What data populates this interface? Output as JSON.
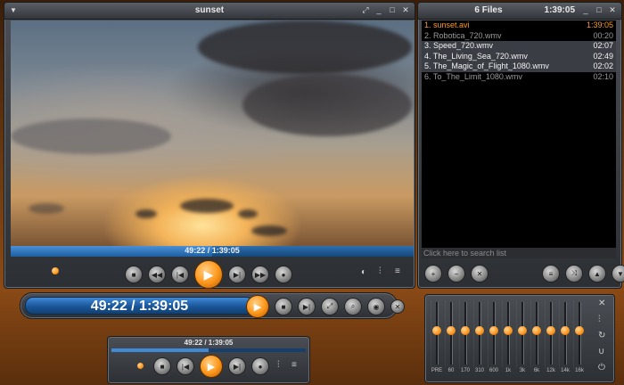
{
  "main_window": {
    "title": "sunset",
    "seek_time": "49:22 / 1:39:05",
    "progress_fraction": 0.5
  },
  "playlist": {
    "title": "6 Files",
    "total_time": "1:39:05",
    "items": [
      {
        "name": "1. sunset.avi",
        "duration": "1:39:05",
        "state": "active"
      },
      {
        "name": "2. Robotica_720.wmv",
        "duration": "00:20",
        "state": "normal"
      },
      {
        "name": "3. Speed_720.wmv",
        "duration": "02:07",
        "state": "selected"
      },
      {
        "name": "4. The_Living_Sea_720.wmv",
        "duration": "02:49",
        "state": "selected"
      },
      {
        "name": "5. The_Magic_of_Flight_1080.wmv",
        "duration": "02:02",
        "state": "selected"
      },
      {
        "name": "6. To_The_Limit_1080.wmv",
        "duration": "02:10",
        "state": "normal"
      }
    ],
    "search_placeholder": "Click here to search list"
  },
  "mini_bar": {
    "time": "49:22 / 1:39:05"
  },
  "small_player": {
    "time": "49:22 / 1:39:05",
    "progress_fraction": 0.5
  },
  "equalizer": {
    "bands": [
      {
        "label": "PRE",
        "level": 0.55
      },
      {
        "label": "60",
        "level": 0.55
      },
      {
        "label": "170",
        "level": 0.55
      },
      {
        "label": "310",
        "level": 0.55
      },
      {
        "label": "600",
        "level": 0.55
      },
      {
        "label": "1k",
        "level": 0.55
      },
      {
        "label": "3k",
        "level": 0.55
      },
      {
        "label": "6k",
        "level": 0.55
      },
      {
        "label": "12k",
        "level": 0.55
      },
      {
        "label": "14k",
        "level": 0.55
      },
      {
        "label": "16k",
        "level": 0.55
      }
    ]
  },
  "colors": {
    "accent_orange": "#ff9a1e",
    "accent_blue": "#2d6fb0"
  }
}
